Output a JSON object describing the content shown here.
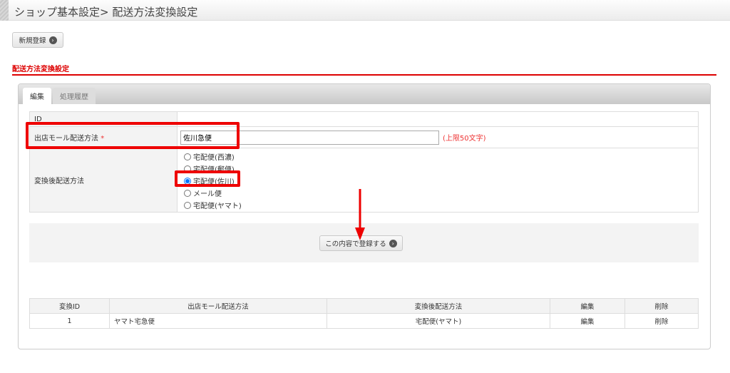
{
  "header": {
    "title": "ショップ基本設定> 配送方法変換設定"
  },
  "toolbar": {
    "new_label": "新規登録"
  },
  "section": {
    "title": "配送方法変換設定"
  },
  "tabs": [
    {
      "label": "編集",
      "active": true
    },
    {
      "label": "処理履歴",
      "active": false
    }
  ],
  "form": {
    "id_label": "ID",
    "id_value": "",
    "mall_label": "出店モール配送方法",
    "required_mark": "*",
    "mall_value": "佐川急便",
    "mall_note": "(上限50文字)",
    "convert_label": "変換後配送方法",
    "options": [
      {
        "label": "宅配便(西濃)",
        "checked": false
      },
      {
        "label": "宅配便(郵便)",
        "checked": false
      },
      {
        "label": "宅配便(佐川)",
        "checked": true
      },
      {
        "label": "メール便",
        "checked": false
      },
      {
        "label": "宅配便(ヤマト)",
        "checked": false
      }
    ],
    "submit_label": "この内容で登録する"
  },
  "list": {
    "headers": [
      "変換ID",
      "出店モール配送方法",
      "変換後配送方法",
      "編集",
      "削除"
    ],
    "rows": [
      {
        "id": "1",
        "mall": "ヤマト宅急便",
        "converted": "宅配便(ヤマト)",
        "edit": "編集",
        "delete": "削除"
      }
    ]
  },
  "colors": {
    "accent": "#dd0000",
    "annotation": "#ee0000"
  }
}
